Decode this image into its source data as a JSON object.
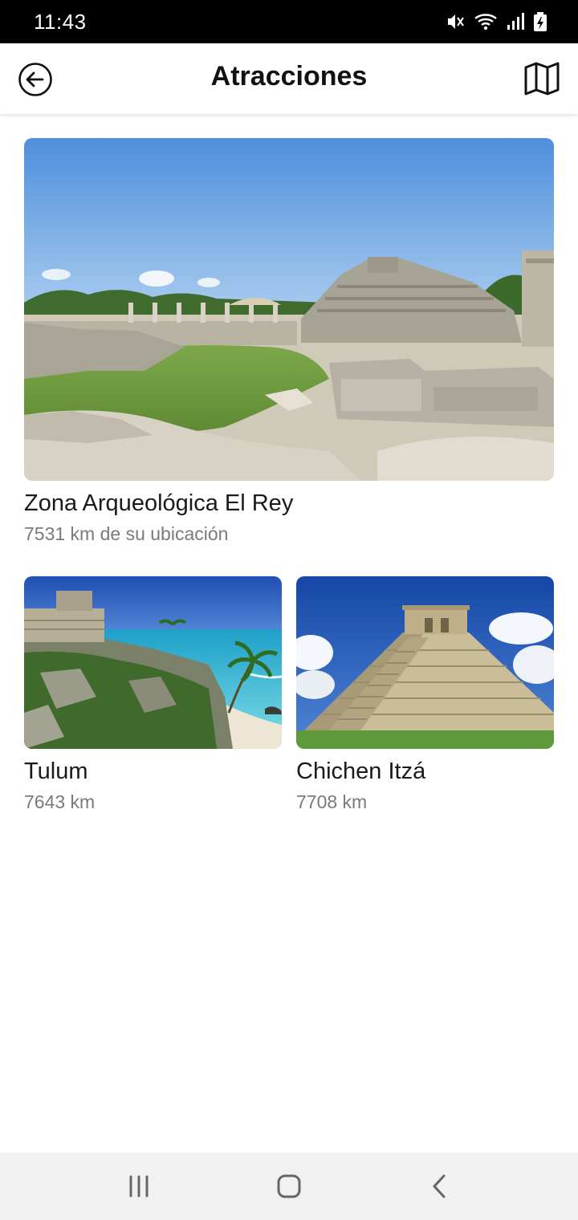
{
  "status_bar": {
    "time": "11:43",
    "icons": [
      "mute-icon",
      "wifi-icon",
      "signal-icon",
      "battery-charging-icon"
    ]
  },
  "app_bar": {
    "title": "Atracciones",
    "back_icon": "arrow-left-circle-icon",
    "map_icon": "map-icon"
  },
  "attractions": [
    {
      "name": "Zona Arqueológica El Rey",
      "distance": "7531 km de su ubicación",
      "image": "el-rey-ruins-photo"
    },
    {
      "name": "Tulum",
      "distance": "7643 km",
      "image": "tulum-photo"
    },
    {
      "name": "Chichen Itzá",
      "distance": "7708 km",
      "image": "chichen-itza-photo"
    }
  ],
  "nav_bar": {
    "icons": [
      "recents-icon",
      "home-icon",
      "back-icon"
    ]
  },
  "colors": {
    "status_bar_bg": "#000000",
    "app_bar_bg": "#ffffff",
    "nav_bar_bg": "#f1f1f1",
    "title_text": "#111111",
    "subtitle_text": "#7a7a7a"
  }
}
